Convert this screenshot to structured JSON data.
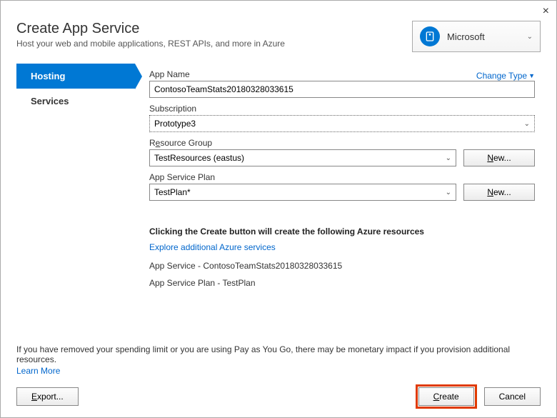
{
  "close": "×",
  "header": {
    "title": "Create App Service",
    "subtitle": "Host your web and mobile applications, REST APIs, and more in Azure",
    "account_name": "Microsoft"
  },
  "sidebar": {
    "tabs": [
      "Hosting",
      "Services"
    ]
  },
  "form": {
    "app_name_label": "App Name",
    "change_type": "Change Type",
    "app_name_value": "ContosoTeamStats20180328033615",
    "subscription_label": "Subscription",
    "subscription_value": "Prototype3",
    "resource_group_label_pre": "R",
    "resource_group_label_u": "e",
    "resource_group_label_post": "source Group",
    "resource_group_value": "TestResources (eastus)",
    "plan_label": "App Service Plan",
    "plan_value": "TestPlan*",
    "new_button": "New..."
  },
  "notice": {
    "title": "Clicking the Create button will create the following Azure resources",
    "explore": "Explore additional Azure services",
    "items": [
      "App Service - ContosoTeamStats20180328033615",
      "App Service Plan - TestPlan"
    ]
  },
  "footer": {
    "note": "If you have removed your spending limit or you are using Pay as You Go, there may be monetary impact if you provision additional resources.",
    "learn_more": "Learn More",
    "export": "Export...",
    "create": "Create",
    "cancel": "Cancel"
  }
}
